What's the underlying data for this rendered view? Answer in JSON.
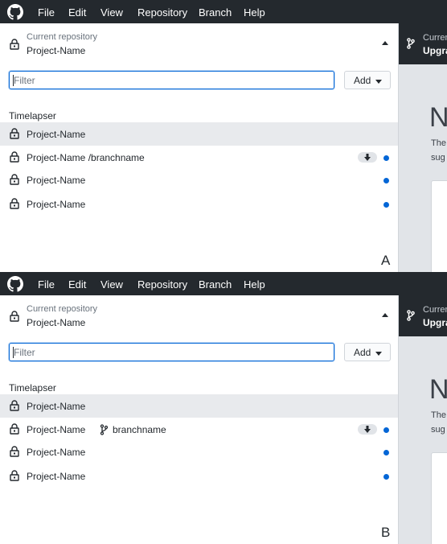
{
  "menu": [
    "File",
    "Edit",
    "View",
    "Repository",
    "Branch",
    "Help"
  ],
  "toolbar": {
    "current_label": "Curren",
    "branch_label": "Upgra"
  },
  "background": {
    "heading": "N",
    "line1": "The",
    "line2": "sug"
  },
  "dropdown": {
    "current_label": "Current repository",
    "current_name": "Project-Name",
    "filter_placeholder": "Filter",
    "add_label": "Add",
    "group": "Timelapser"
  },
  "panel_a": {
    "letter": "A",
    "repos": [
      {
        "name": "Project-Name"
      },
      {
        "name": "Project-Name /branchname"
      },
      {
        "name": "Project-Name"
      },
      {
        "name": "Project-Name"
      }
    ]
  },
  "panel_b": {
    "letter": "B",
    "repos": [
      {
        "name": "Project-Name"
      },
      {
        "name": "Project-Name",
        "branch": "branchname"
      },
      {
        "name": "Project-Name"
      },
      {
        "name": "Project-Name"
      }
    ]
  },
  "colors": {
    "menubar": "#24292e",
    "accent": "#0366d6",
    "selected_row": "#e8eaed"
  }
}
